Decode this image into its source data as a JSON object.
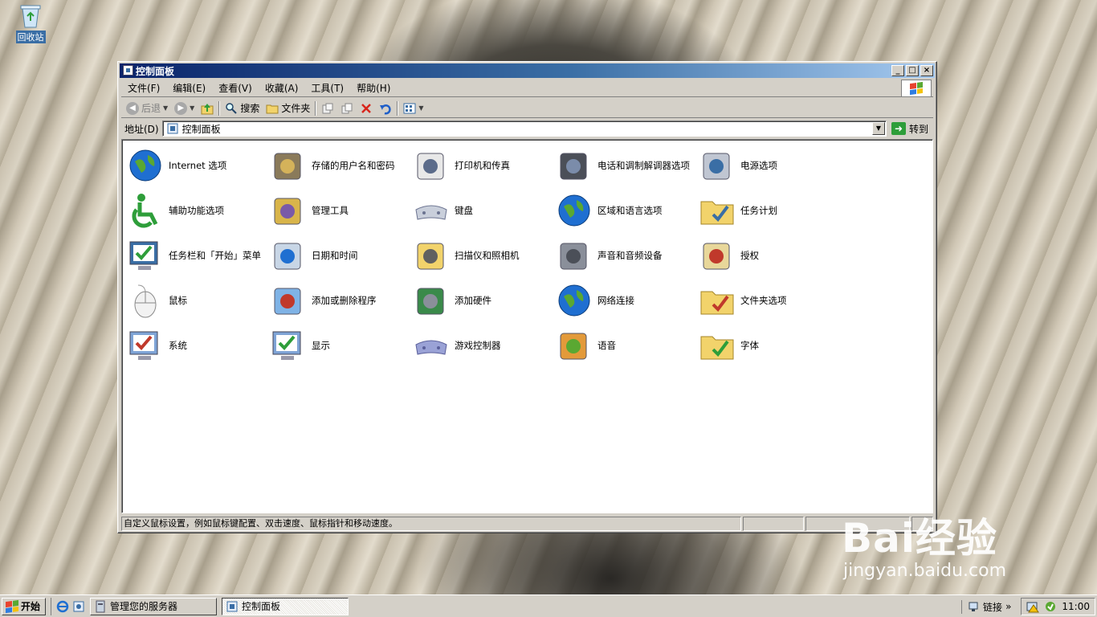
{
  "desktop": {
    "recycle_bin_label": "回收站"
  },
  "window": {
    "title": "控制面板",
    "menu": [
      "文件(F)",
      "编辑(E)",
      "查看(V)",
      "收藏(A)",
      "工具(T)",
      "帮助(H)"
    ],
    "toolbar": {
      "back": "后退",
      "search": "搜索",
      "folders": "文件夹"
    },
    "address": {
      "label": "地址(D)",
      "value": "控制面板",
      "go": "转到"
    },
    "items": [
      {
        "label": "Internet 选项",
        "icon": "internet-options-icon"
      },
      {
        "label": "存储的用户名和密码",
        "icon": "stored-passwords-icon"
      },
      {
        "label": "打印机和传真",
        "icon": "printers-faxes-icon"
      },
      {
        "label": "电话和调制解调器选项",
        "icon": "phone-modem-icon"
      },
      {
        "label": "电源选项",
        "icon": "power-options-icon"
      },
      {
        "label": "辅助功能选项",
        "icon": "accessibility-icon"
      },
      {
        "label": "管理工具",
        "icon": "admin-tools-icon"
      },
      {
        "label": "键盘",
        "icon": "keyboard-icon"
      },
      {
        "label": "区域和语言选项",
        "icon": "regional-language-icon"
      },
      {
        "label": "任务计划",
        "icon": "scheduled-tasks-icon"
      },
      {
        "label": "任务栏和「开始」菜单",
        "icon": "taskbar-start-menu-icon"
      },
      {
        "label": "日期和时间",
        "icon": "date-time-icon"
      },
      {
        "label": "扫描仪和照相机",
        "icon": "scanner-camera-icon"
      },
      {
        "label": "声音和音频设备",
        "icon": "sound-audio-icon"
      },
      {
        "label": "授权",
        "icon": "licensing-icon"
      },
      {
        "label": "鼠标",
        "icon": "mouse-icon"
      },
      {
        "label": "添加或删除程序",
        "icon": "add-remove-programs-icon"
      },
      {
        "label": "添加硬件",
        "icon": "add-hardware-icon"
      },
      {
        "label": "网络连接",
        "icon": "network-connections-icon"
      },
      {
        "label": "文件夹选项",
        "icon": "folder-options-icon"
      },
      {
        "label": "系统",
        "icon": "system-icon"
      },
      {
        "label": "显示",
        "icon": "display-icon"
      },
      {
        "label": "游戏控制器",
        "icon": "game-controllers-icon"
      },
      {
        "label": "语音",
        "icon": "speech-icon"
      },
      {
        "label": "字体",
        "icon": "fonts-icon"
      }
    ],
    "status": "自定义鼠标设置，例如鼠标键配置、双击速度、鼠标指针和移动速度。"
  },
  "watermark": {
    "brand": "Bai经验",
    "url": "jingyan.baidu.com"
  },
  "taskbar": {
    "start": "开始",
    "tasks": [
      "管理您的服务器",
      "控制面板"
    ],
    "links": "链接",
    "clock": "11:00"
  },
  "colors": {
    "titlebar": "#0a246a",
    "face": "#d4d0c8",
    "desktop": "#c5bca9"
  }
}
